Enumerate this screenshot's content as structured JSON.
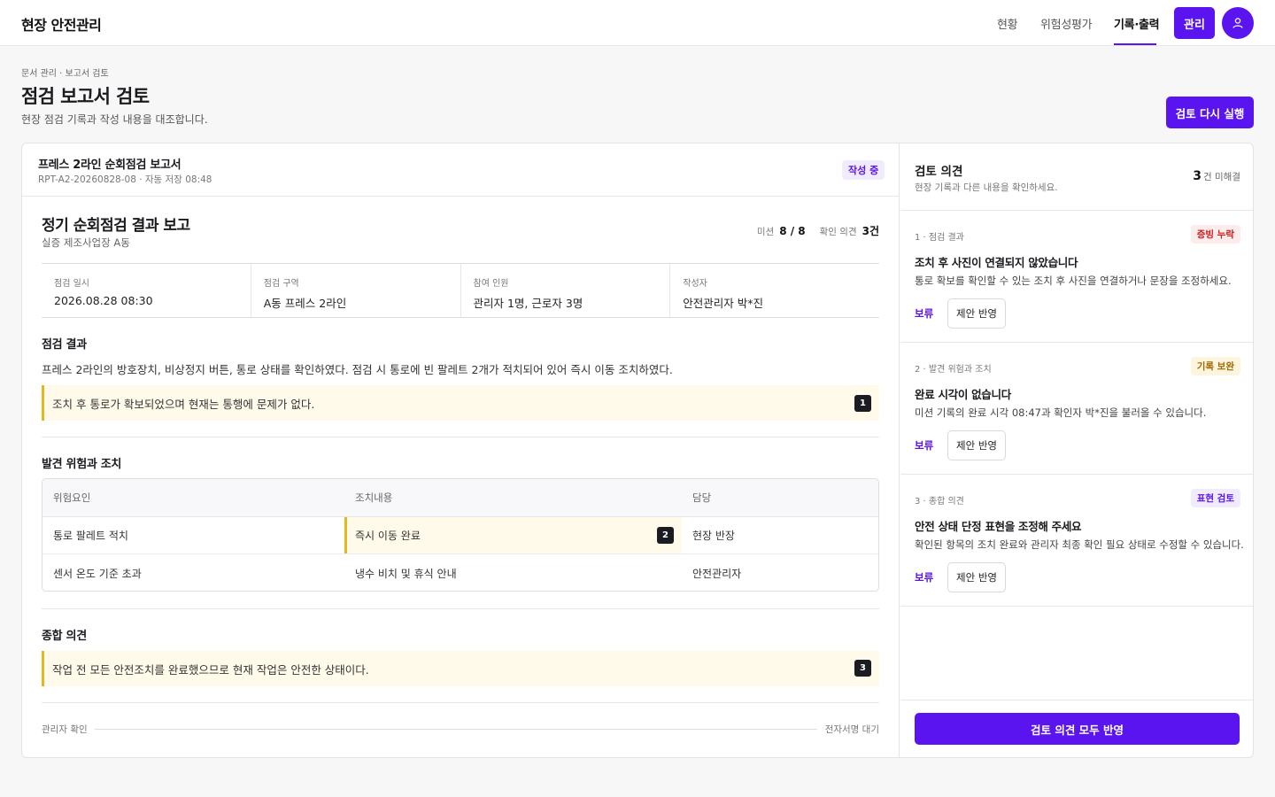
{
  "app": {
    "brand": "현장 안전관리"
  },
  "nav": {
    "items": [
      {
        "label": "현황"
      },
      {
        "label": "위험성평가"
      },
      {
        "label": "기록·출력"
      }
    ],
    "admin_label": "관리"
  },
  "page": {
    "breadcrumb": "문서 관리 · 보고서 검토",
    "title": "점검 보고서 검토",
    "subtitle": "현장 점검 기록과 작성 내용을 대조합니다.",
    "rerun_label": "검토 다시 실행"
  },
  "document": {
    "name": "프레스 2라인 순회점검 보고서",
    "meta": "RPT-A2-20260828-08 · 자동 저장 08:48",
    "status": "작성 중",
    "report_title": "정기 순회점검 결과 보고",
    "site": "실증 제조사업장 A동",
    "stats": {
      "mission_label": "미션",
      "mission_value": "8 / 8",
      "check_label": "확인 의견",
      "check_value": "3건"
    },
    "info": [
      {
        "label": "점검 일시",
        "value": "2026.08.28 08:30"
      },
      {
        "label": "점검 구역",
        "value": "A동 프레스 2라인"
      },
      {
        "label": "참여 인원",
        "value": "관리자 1명, 근로자 3명"
      },
      {
        "label": "작성자",
        "value": "안전관리자 박*진"
      }
    ],
    "result_title": "점검 결과",
    "result_text": "프레스 2라인의 방호장치, 비상정지 버튼, 통로 상태를 확인하였다. 점검 시 통로에 빈 팔레트 2개가 적치되어 있어 즉시 이동 조치하였다.",
    "result_highlight": "조치 후 통로가 확보되었으며 현재는 통행에 문제가 없다.",
    "marker1": "1",
    "risk_title": "발견 위험과 조치",
    "risk_headers": [
      "위험요인",
      "조치내용",
      "담당"
    ],
    "risk_rows": [
      {
        "hazard": "통로 팔레트 적치",
        "action": "즉시 이동 완료",
        "owner": "현장 반장",
        "marker": "2"
      },
      {
        "hazard": "센서 온도 기준 초과",
        "action": "냉수 비치 및 휴식 안내",
        "owner": "안전관리자"
      }
    ],
    "summary_title": "종합 의견",
    "summary_highlight": "작업 전 모든 안전조치를 완료했으므로 현재 작업은 안전한 상태이다.",
    "marker3": "3",
    "sign_label": "관리자 확인",
    "sign_status": "전자서명 대기"
  },
  "review": {
    "title": "검토 의견",
    "subtitle": "현장 기록과 다른 내용을 확인하세요.",
    "count": "3",
    "count_suffix": "건 미해결",
    "items": [
      {
        "category": "1 · 점검 결과",
        "tag": "증빙 누락",
        "heading": "조치 후 사진이 연결되지 않았습니다",
        "desc": "통로 확보를 확인할 수 있는 조치 후 사진을 연결하거나 문장을 조정하세요.",
        "hold": "보류",
        "apply": "제안 반영"
      },
      {
        "category": "2 · 발견 위험과 조치",
        "tag": "기록 보완",
        "heading": "완료 시각이 없습니다",
        "desc": "미션 기록의 완료 시각 08:47과 확인자 박*진을 불러올 수 있습니다.",
        "hold": "보류",
        "apply": "제안 반영"
      },
      {
        "category": "3 · 종합 의견",
        "tag": "표현 검토",
        "heading": "안전 상태 단정 표현을 조정해 주세요",
        "desc": "확인된 항목의 조치 완료와 관리자 최종 확인 필요 상태로 수정할 수 있습니다.",
        "hold": "보류",
        "apply": "제안 반영"
      }
    ],
    "apply_all": "검토 의견 모두 반영"
  },
  "colors": {
    "accent": "#5a14f0",
    "highlight_bg": "#fffaea",
    "highlight_bar": "#e5b620"
  }
}
